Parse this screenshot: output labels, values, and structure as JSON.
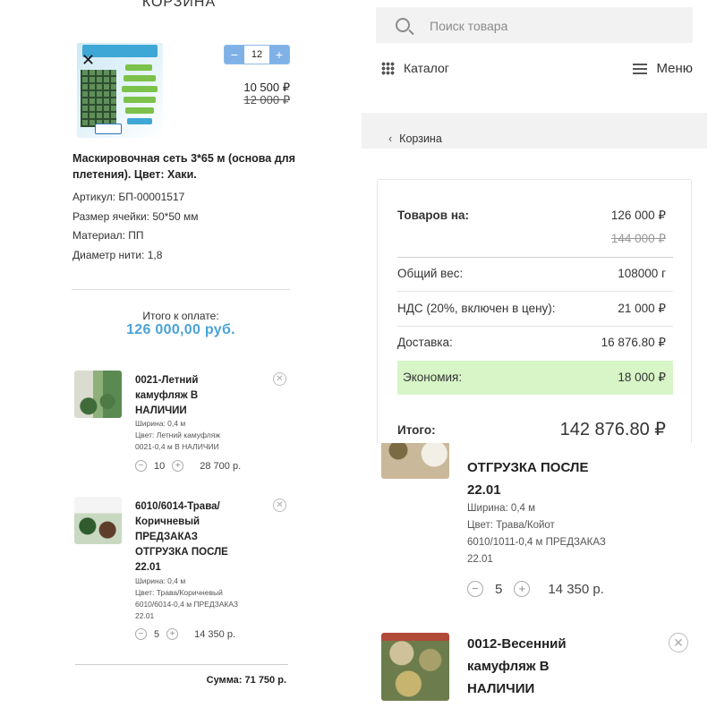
{
  "left": {
    "page_title": "КОРЗИНА",
    "product": {
      "quantity": "12",
      "minus": "−",
      "plus": "+",
      "price_new": "10 500 ₽",
      "price_old": "12 000 ₽",
      "name": "Маскировочная сеть 3*65 м (основа для плетения). Цвет: Хаки.",
      "specs": [
        "Артикул: БП-00001517",
        "Размер ячейки: 50*50 мм",
        "Материал: ПП",
        "Диаметр нити: 1,8"
      ]
    },
    "total_label": "Итого к оплате:",
    "total_value": "126 000,00 руб.",
    "items": [
      {
        "name": "0021-Летний камуфляж В НАЛИЧИИ",
        "meta": [
          "Ширина: 0,4 м",
          "Цвет: Летний камуфляж",
          "0021-0,4 м В НАЛИЧИИ"
        ],
        "qty": "10",
        "price": "28 700 р."
      },
      {
        "name": "6010/6014-Трава/ Коричневый ПРЕДЗАКАЗ ОТГРУЗКА ПОСЛЕ 22.01",
        "meta": [
          "Ширина: 0,4 м",
          "Цвет: Трава/Коричневый",
          "6010/6014-0,4 м ПРЕДЗАКАЗ",
          "22.01"
        ],
        "qty": "5",
        "price": "14 350 р."
      }
    ],
    "sum": "Сумма: 71 750 р."
  },
  "right_top": {
    "search_placeholder": "Поиск товара",
    "catalog": "Каталог",
    "menu": "Меню",
    "breadcrumb": "Корзина",
    "summary": {
      "goods_label": "Товаров на:",
      "goods_value": "126 000 ₽",
      "goods_old": "144 000 ₽",
      "weight_label": "Общий вес:",
      "weight_value": "108000 г",
      "vat_label": "НДС (20%, включен в цену):",
      "vat_value": "21 000 ₽",
      "delivery_label": "Доставка:",
      "delivery_value": "16 876.80 ₽",
      "savings_label": "Экономия:",
      "savings_value": "18 000 ₽",
      "total_label": "Итого:",
      "total_value": "142 876.80 ₽"
    }
  },
  "right_bottom": {
    "item1": {
      "name_tail": [
        "ОТГРУЗКА ПОСЛЕ",
        "22.01"
      ],
      "meta": [
        "Ширина: 0,4 м",
        "Цвет: Трава/Койот",
        "6010/1011-0,4 м ПРЕДЗАКАЗ",
        "22.01"
      ],
      "qty": "5",
      "price": "14 350 р."
    },
    "item2": {
      "name": [
        "0012-Весенний",
        "камуфляж В",
        "НАЛИЧИИ"
      ]
    }
  },
  "colors": {
    "accent_blue": "#4aa3d8",
    "savings_green": "#d7f5c7"
  }
}
